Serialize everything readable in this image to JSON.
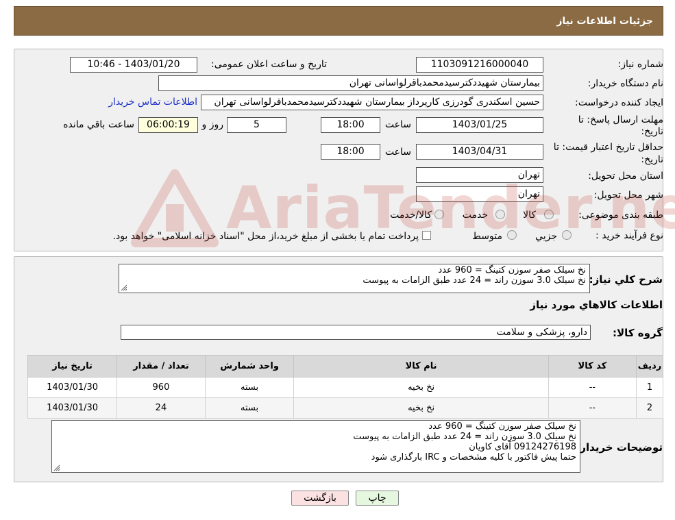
{
  "header": {
    "title": "جزئیات اطلاعات نیاز"
  },
  "form": {
    "need_number_label": "شماره نیاز:",
    "need_number_value": "1103091216000040",
    "announce_label": "تاریخ و ساعت اعلان عمومی:",
    "announce_value": "1403/01/20 - 10:46",
    "buyer_org_label": "نام دستگاه خریدار:",
    "buyer_org_value": "بیمارستان شهیددکترسیدمحمدباقرلواسانی تهران",
    "requester_label": "ایجاد کننده درخواست:",
    "requester_value": "حسین اسکندری گودرزی کارپرداز بیمارستان شهیددکترسیدمحمدباقرلواسانی تهران",
    "contact_link": "اطلاعات تماس خریدار",
    "deadline_label_1": "مهلت ارسال پاسخ: تا",
    "deadline_label_2": "تاریخ:",
    "deadline_date": "1403/01/25",
    "time_label": "ساعت",
    "deadline_time": "18:00",
    "days_value": "5",
    "days_label": "روز و",
    "remaining_value": "06:00:19",
    "remaining_label": "ساعت باقي مانده",
    "validity_label_1": "حداقل تاریخ اعتبار قیمت: تا",
    "validity_label_2": "تاریخ:",
    "validity_date": "1403/04/31",
    "validity_time": "18:00",
    "province_label": "استان محل تحویل:",
    "province_value": "تهران",
    "city_label": "شهر محل تحویل:",
    "city_value": "تهران",
    "category_label": "طبقه بندی موضوعی:",
    "category_options": [
      "کالا",
      "خدمت",
      "کالا/خدمت"
    ],
    "process_label": "نوع فرآیند خرید :",
    "process_options": [
      "جزیي",
      "متوسط"
    ],
    "process_note": "پرداخت تمام یا بخشی از مبلغ خرید،از محل \"اسناد خزانه اسلامی\" خواهد بود."
  },
  "summary": {
    "label": "شرح کلي نياز:",
    "lines": [
      "نخ سیلک صفر سوزن کتینگ = 960 عدد",
      "نخ سیلک 3.0 سوزن راند = 24 عدد طبق الزامات به پیوست"
    ],
    "items_heading": "اطلاعات کالاهاي مورد نياز",
    "group_label": "گروه کالا:",
    "group_value": "دارو، پزشکی و سلامت"
  },
  "table": {
    "columns": [
      "رديف",
      "کد کالا",
      "نام کالا",
      "واحد شمارش",
      "تعداد / مقدار",
      "تاریخ نیاز"
    ],
    "rows": [
      [
        "1",
        "--",
        "نخ بخیه",
        "بسته",
        "960",
        "1403/01/30"
      ],
      [
        "2",
        "--",
        "نخ بخیه",
        "بسته",
        "24",
        "1403/01/30"
      ]
    ]
  },
  "buyer_notes": {
    "label": "توضیحات خریدار:",
    "lines": [
      "نخ سیلک صفر سوزن کتینگ = 960 عدد",
      "نخ سیلک 3.0 سوزن راند = 24 عدد طبق الزامات به پیوست",
      "09124276198 آقای کاویان",
      "حتما پیش فاکتور با کلیه مشخصات و IRC بارگذاری شود"
    ]
  },
  "buttons": {
    "print": "چاپ",
    "back": "بازگشت"
  },
  "watermark": {
    "text": "AriaTender.neT"
  },
  "colors": {
    "header": "#8b6b43",
    "link": "#1a2fc8",
    "print_button": "#e6f7df",
    "back_button": "#fbe1e1",
    "watermark": "#c0392b"
  }
}
